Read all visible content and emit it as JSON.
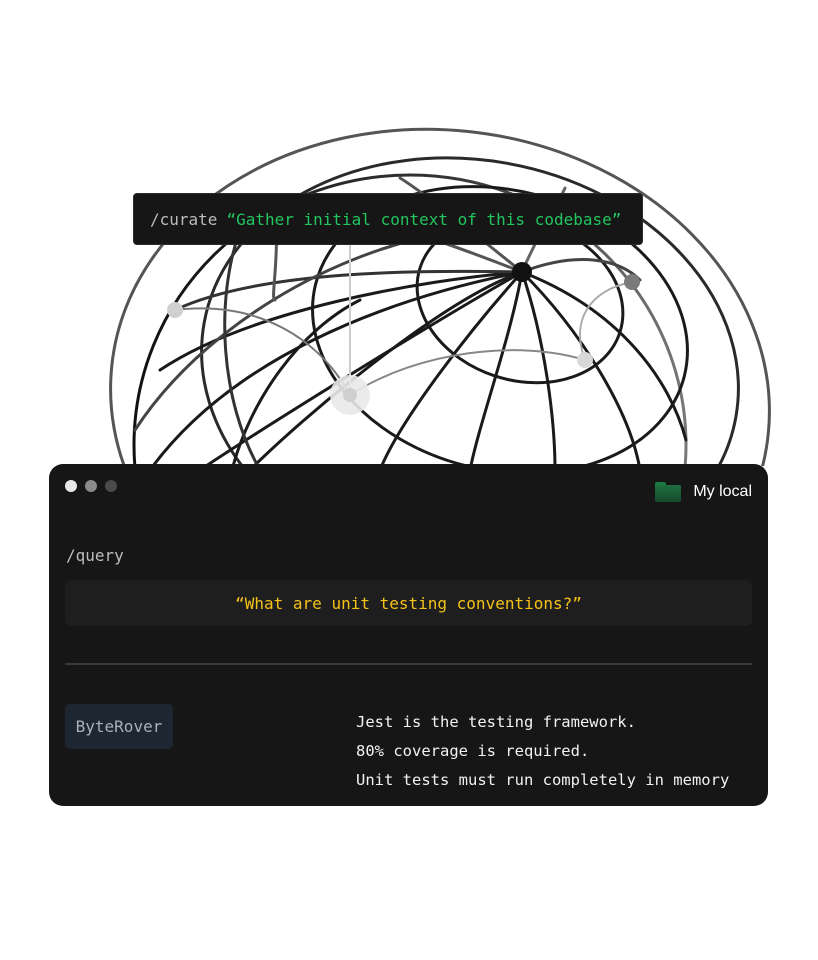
{
  "curate": {
    "command": "/curate",
    "text": "“Gather initial context of this codebase”"
  },
  "terminal": {
    "location": {
      "icon": "folder-icon",
      "label": "My local"
    },
    "query": {
      "command": "/query",
      "text": "“What are unit testing conventions?”"
    },
    "response": {
      "agent_label": "ByteRover",
      "lines": [
        "Jest is the testing framework.",
        "80% coverage is required.",
        "Unit tests must run completely in memory"
      ]
    }
  },
  "colors": {
    "terminal_bg": "#161616",
    "curate_text": "#22c55e",
    "query_text": "#f5c218",
    "folder": "#1d7a44"
  }
}
